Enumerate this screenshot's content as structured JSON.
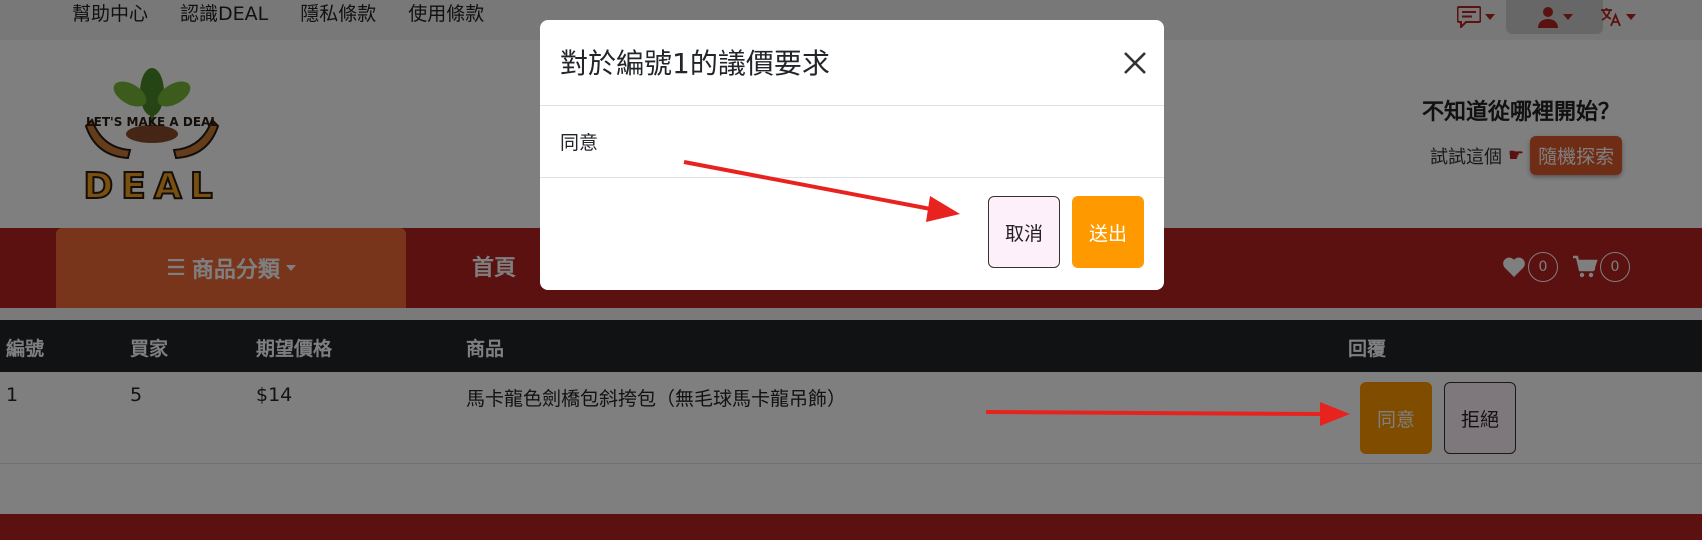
{
  "topbar": {
    "links": [
      "幫助中心",
      "認識DEAL",
      "隱私條款",
      "使用條款"
    ]
  },
  "header": {
    "logo_text_top": "LET'S MAKE A DEAL",
    "logo_text_bottom": "DEAL",
    "help_title": "不知道從哪裡開始？",
    "help_prompt": "試試這個",
    "random_button": "隨機探索"
  },
  "nav": {
    "category_button": "商品分類",
    "home": "首頁",
    "wishlist_count": "0",
    "cart_count": "0"
  },
  "table": {
    "headers": {
      "id": "編號",
      "buyer": "買家",
      "price": "期望價格",
      "product": "商品",
      "reply": "回覆"
    },
    "row": {
      "id": "1",
      "buyer": "5",
      "price": "$14",
      "product": "馬卡龍色劍橋包斜挎包（無毛球馬卡龍吊飾）",
      "agree": "同意",
      "reject": "拒絕"
    }
  },
  "modal": {
    "title": "對於編號1的議價要求",
    "body": "同意",
    "cancel": "取消",
    "submit": "送出"
  },
  "colors": {
    "brand_red": "#b5221f",
    "accent_orange": "#ff9900",
    "category_orange": "#f26a36",
    "annotation_arrow": "#e8231f"
  }
}
